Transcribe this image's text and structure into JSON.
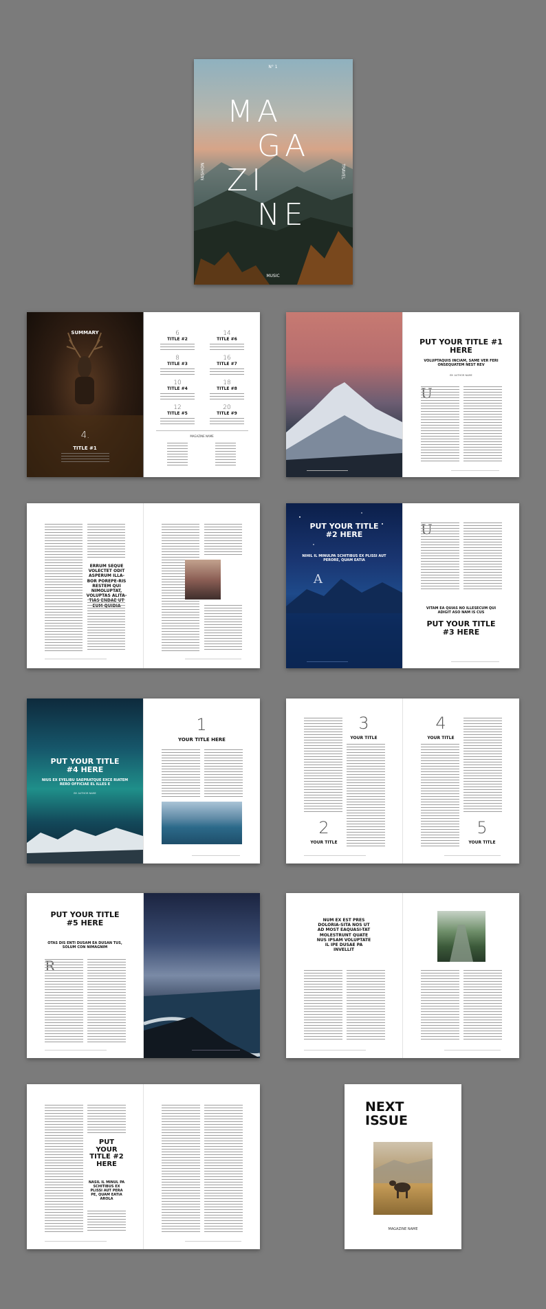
{
  "cover": {
    "issue_no": "N° 1",
    "title_lines": [
      "MA",
      "GA",
      "ZI",
      "NE"
    ],
    "side_left": "FASHION",
    "side_right": "TRAVEL",
    "bottom": "MUSIC"
  },
  "summary": {
    "heading": "SUMMARY",
    "featured_number": "4.",
    "featured_title": "TITLE #1",
    "entries": [
      {
        "num": "6",
        "title": "TITLE #2"
      },
      {
        "num": "14",
        "title": "TITLE #6"
      },
      {
        "num": "8",
        "title": "TITLE #3"
      },
      {
        "num": "16",
        "title": "TITLE #7"
      },
      {
        "num": "10",
        "title": "TITLE #4"
      },
      {
        "num": "18",
        "title": "TITLE #8"
      },
      {
        "num": "12",
        "title": "TITLE #5"
      },
      {
        "num": "20",
        "title": "TITLE #9"
      }
    ],
    "footer_label": "MAGAZINE NAME"
  },
  "spread_title1": {
    "title": "PUT YOUR TITLE #1 HERE",
    "subtitle": "VOLUPTAQUIS INCIAM, SAME VER FERI ONSEQUATEM NEST REV",
    "byline": "BY: AUTHOR NAME",
    "dropcap": "U"
  },
  "spread_quote": {
    "quote": "ERRUM SEQUE VOLECTET ODIT ASPERUM ILLA-BOR POREPE-RIS RESTEM QUI NIMOLUPTAT, VOLUPTAS ALITA-TIAS ENDAE UT EUM QUIDIA"
  },
  "spread_title2": {
    "title": "PUT YOUR TITLE #2 HERE",
    "subtitle": "NIHIL IL MINULPA SCHITIBUS EX PLISSI AUT PERORE, QUAM EATIA",
    "dropcap_left": "A",
    "dropcap_right": "U",
    "quote": "VITAM EA QUIAS NO ILLESECUM QUI ADIGIT ASO NAM IS CUS",
    "title3": "PUT YOUR TITLE #3 HERE"
  },
  "spread_title4": {
    "title": "PUT YOUR TITLE #4 HERE",
    "subtitle": "NIUS EX EYELIBU SAEPRATQUE EXCE RIATEM RERO OFFICIAE EL ILLES E",
    "byline": "BY: AUTHOR NAME",
    "num": "1",
    "right_title": "YOUR TITLE HERE"
  },
  "spread_numbers": {
    "items": [
      {
        "num": "3",
        "label": "YOUR TITLE"
      },
      {
        "num": "2",
        "label": "YOUR TITLE"
      },
      {
        "num": "4",
        "label": "YOUR TITLE"
      },
      {
        "num": "5",
        "label": "YOUR TITLE"
      }
    ]
  },
  "spread_title5": {
    "title": "PUT YOUR TITLE #5 HERE",
    "subtitle": "OTAS DIS ENTI DUSAM EA DUSAN TUS, SOLUM CON NIMAGNIM",
    "dropcap": "R"
  },
  "spread_bridge": {
    "quote": "NUM EX EST PRES DOLORIA-SITA NOS UT AD MOST EAQUASI-TAT MOLESTRUNT QUATE NUS IPSAM VOLUPTATE IL IPE DUSAE PA INVELLIT"
  },
  "spread_last": {
    "title": "PUT YOUR TITLE #2 HERE",
    "subtitle": "NASIL IL MINUL PA SCHITIBUS EX PLISSI AUT PERA PE, QUAM EATIA AROLA"
  },
  "next_issue": {
    "title": "NEXT ISSUE",
    "footer": "MAGAZINE NAME"
  }
}
